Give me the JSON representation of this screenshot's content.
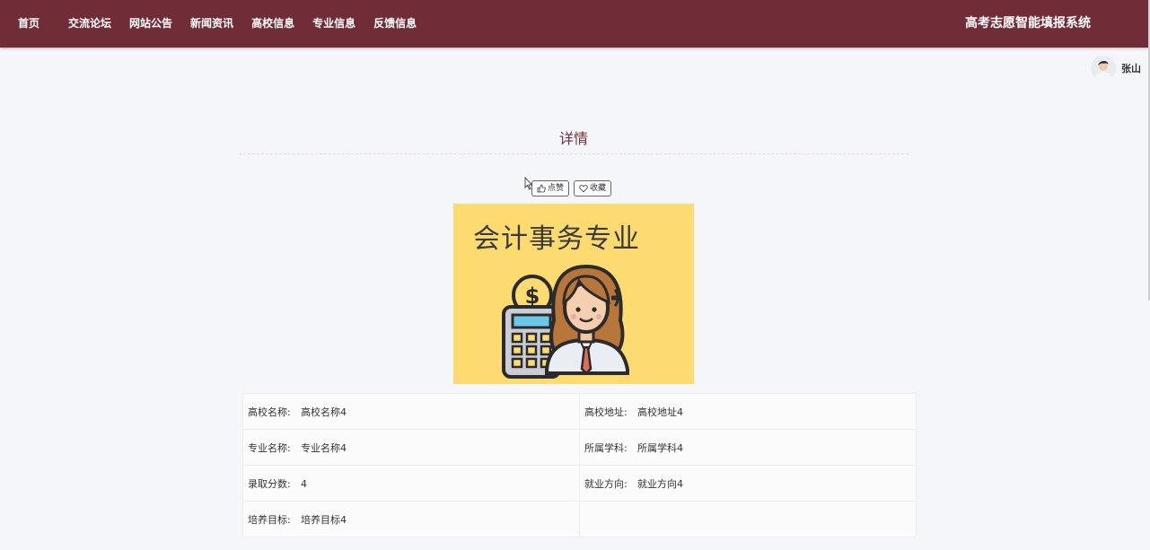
{
  "nav": {
    "items": [
      {
        "label": "首页"
      },
      {
        "label": "交流论坛"
      },
      {
        "label": "网站公告"
      },
      {
        "label": "新闻资讯"
      },
      {
        "label": "高校信息"
      },
      {
        "label": "专业信息"
      },
      {
        "label": "反馈信息"
      }
    ],
    "brand": "高考志愿智能填报系统"
  },
  "user": {
    "name": "张山"
  },
  "page": {
    "title": "详情"
  },
  "actions": {
    "like_label": "点赞",
    "favorite_label": "收藏"
  },
  "banner": {
    "text": "会计事务专业"
  },
  "details": [
    {
      "label": "高校名称:",
      "value": "高校名称4"
    },
    {
      "label": "高校地址:",
      "value": "高校地址4"
    },
    {
      "label": "专业名称:",
      "value": "专业名称4"
    },
    {
      "label": "所属学科:",
      "value": "所属学科4"
    },
    {
      "label": "录取分数:",
      "value": "4"
    },
    {
      "label": "就业方向:",
      "value": "就业方向4"
    },
    {
      "label": "培养目标:",
      "value": "培养目标4"
    }
  ],
  "colors": {
    "brand": "#712d37",
    "banner_bg": "#fedb71",
    "background": "#f5f6f9"
  }
}
